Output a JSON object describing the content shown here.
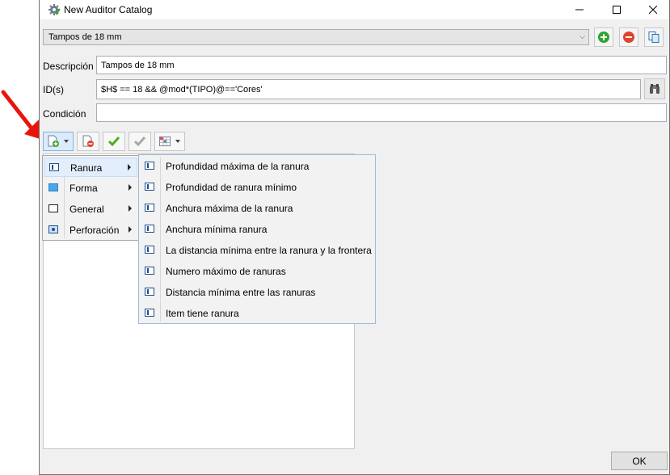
{
  "window": {
    "title": "New Auditor Catalog"
  },
  "catalog": {
    "selected": "Tampos de 18 mm"
  },
  "form": {
    "descripcion_label": "Descripción",
    "descripcion_value": "Tampos de 18 mm",
    "ids_label": "ID(s)",
    "ids_value": "$H$ == 18 && @mod*(TIPO)@=='Cores'",
    "condicion_label": "Condición",
    "condicion_value": ""
  },
  "menu": {
    "items": [
      {
        "label": "Ranura",
        "icon": "groove-icon"
      },
      {
        "label": "Forma",
        "icon": "shape-icon"
      },
      {
        "label": "General",
        "icon": "general-icon"
      },
      {
        "label": "Perforación",
        "icon": "drilling-icon"
      }
    ],
    "submenu": [
      {
        "label": "Profundidad máxima de la ranura"
      },
      {
        "label": "Profundidad de ranura mínimo"
      },
      {
        "label": "Anchura máxima de la ranura"
      },
      {
        "label": "Anchura mínima ranura"
      },
      {
        "label": "La distancia mínima entre la ranura y la frontera"
      },
      {
        "label": "Numero máximo de ranuras"
      },
      {
        "label": "Distancia mínima entre las ranuras"
      },
      {
        "label": "Item tiene ranura"
      }
    ]
  },
  "footer": {
    "ok_label": "OK"
  },
  "colors": {
    "accent": "#0078d7",
    "add_green": "#2ea52e",
    "remove_red": "#e0442c",
    "annotation_red": "#e8140c"
  }
}
